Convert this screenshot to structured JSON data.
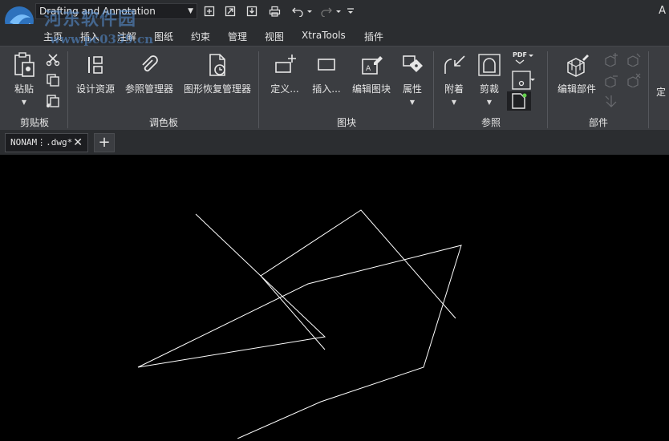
{
  "titlebar": {
    "workspace": "Drafting and Annotation",
    "edge_text": "A",
    "quick_access": [
      "new-icon",
      "open-icon",
      "save-icon",
      "print-icon",
      "undo-icon",
      "redo-icon",
      "customize-icon"
    ]
  },
  "watermark": {
    "line1": "河东软件园",
    "line2": "www.pc0359.cn"
  },
  "menu": [
    "主页",
    "插入",
    "注解",
    "图纸",
    "约束",
    "管理",
    "视图",
    "XtraTools",
    "插件"
  ],
  "ribbon": {
    "groups": {
      "clipboard": "剪贴板",
      "palette": "调色板",
      "block": "图块",
      "reference": "参照",
      "component": "部件"
    },
    "buttons": {
      "paste": "粘贴",
      "design_resources": "设计资源",
      "xref_manager": "参照管理器",
      "drawing_recovery": "图形恢复管理器",
      "define": "定义...",
      "insert": "插入...",
      "edit_block": "编辑图块",
      "attributes": "属性",
      "attach": "附着",
      "clip": "剪裁",
      "edit_component": "编辑部件",
      "truncated": "定"
    },
    "pdf_label": "PDF"
  },
  "tabs": {
    "document": "NONAM⋮.dwg*",
    "close": "✕",
    "add": "+"
  },
  "colors": {
    "accent": "#3b8ee8",
    "ribbon_bg": "#3b3d41",
    "title_bg": "#2b2d30",
    "canvas_bg": "#000000",
    "line": "#ffffff"
  }
}
